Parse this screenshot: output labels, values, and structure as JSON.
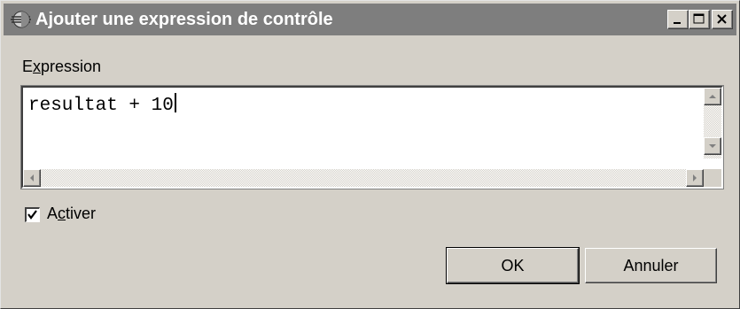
{
  "window": {
    "title": "Ajouter une expression de contrôle",
    "controls": {
      "minimize": "minimize-icon",
      "maximize": "maximize-icon",
      "close": "close-icon"
    }
  },
  "form": {
    "expression_label_pre": "E",
    "expression_label_accel": "x",
    "expression_label_post": "pression",
    "expression_value": "resultat + 10",
    "activer_label_pre": "A",
    "activer_label_accel": "c",
    "activer_label_post": "tiver",
    "activer_checked": true
  },
  "buttons": {
    "ok_label": "OK",
    "cancel_label": "Annuler"
  },
  "colors": {
    "titlebar": "#7e7e7e",
    "dialog_bg": "#d4d0c8"
  }
}
